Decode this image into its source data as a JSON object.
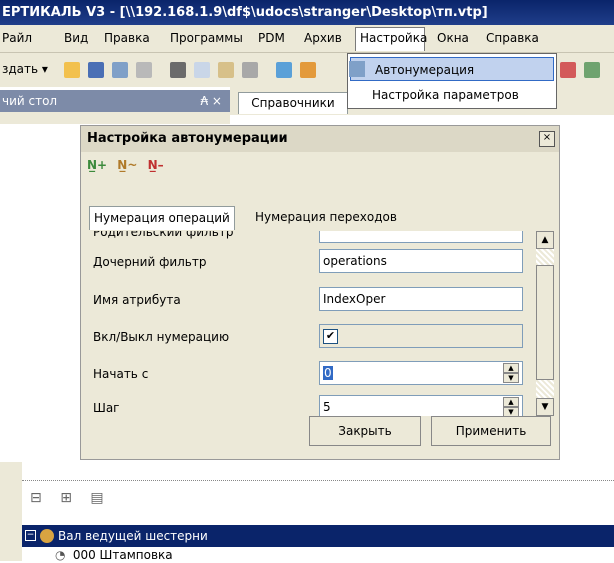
{
  "window": {
    "title": "ЕРТИКАЛЬ V3 - [\\\\192.168.1.9\\df$\\udocs\\stranger\\Desktop\\тп.vtp]"
  },
  "menu": {
    "items": [
      "Райл",
      "Вид",
      "Правка",
      "Программы",
      "PDM",
      "Архив",
      "Настройка",
      "Окна",
      "Справка"
    ],
    "active": "Настройка"
  },
  "toolbar": {
    "create_label": "здать ▾"
  },
  "dock": {
    "left_title": "чий стол",
    "pin": "₳ ×",
    "tab_label": "Справочники"
  },
  "dropdown": {
    "items": [
      "Автонумерация",
      "Настройка параметров"
    ]
  },
  "dialog": {
    "title": "Настройка автонумерации",
    "close": "×",
    "toolbar_icons": [
      "N̲+",
      "N̲~",
      "N̲–"
    ],
    "tabs": [
      "Нумерация операций",
      "Нумерация переходов"
    ],
    "rows": [
      {
        "label": "Родительский фильтр",
        "value": ""
      },
      {
        "label": "Дочерний фильтр",
        "value": "operations"
      },
      {
        "label": "Имя атрибута",
        "value": "IndexOper"
      },
      {
        "label": "Вкл/Выкл нумерацию",
        "checked": true
      },
      {
        "label": "Начать с",
        "value": "0"
      },
      {
        "label": "Шаг",
        "value": "5"
      }
    ],
    "buttons": {
      "close": "Закрыть",
      "apply": "Применить"
    }
  },
  "tree": {
    "root": "Вал ведущей шестерни",
    "child": "000 Штамповка"
  }
}
